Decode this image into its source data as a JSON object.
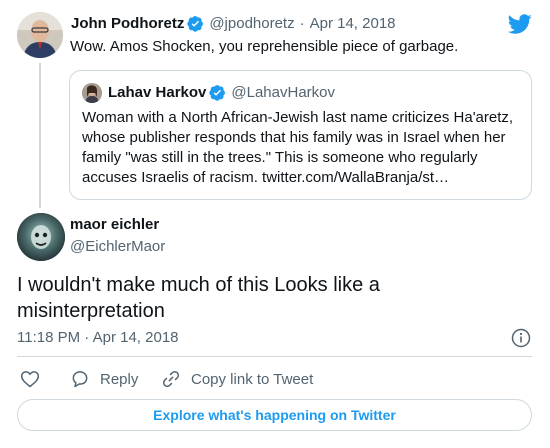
{
  "brand": {
    "logo_icon": "twitter-bird-icon",
    "accent_color": "#1d9bf0"
  },
  "parent_tweet": {
    "author_name": "John Podhoretz",
    "author_handle": "@jpodhoretz",
    "date_separator": "·",
    "date": "Apr 14, 2018",
    "text": "Wow. Amos Shocken, you reprehensible piece of garbage.",
    "verified_icon": "verified-badge-icon"
  },
  "quoted_tweet": {
    "author_name": "Lahav Harkov",
    "author_handle": "@LahavHarkov",
    "verified_icon": "verified-badge-icon",
    "text_lines": [
      "Woman with a North African-Jewish last name criticizes Ha'aretz,",
      "whose publisher responds that his family was in Israel when her",
      "family \"was still in the trees.\" This is someone who regularly",
      "accuses Israelis of racism. twitter.com/WallaBranja/st…"
    ]
  },
  "main_tweet": {
    "author_name": "maor eichler",
    "author_handle": "@EichlerMaor",
    "text_lines": [
      "I wouldn't make much of this Looks like a",
      "misinterpretation"
    ],
    "time": "11:18 PM",
    "date_separator": "·",
    "date": "Apr 14, 2018",
    "info_icon": "info-icon"
  },
  "actions": {
    "like_icon": "heart-icon",
    "reply_icon": "reply-bubble-icon",
    "reply_label": "Reply",
    "copy_icon": "link-icon",
    "copy_label": "Copy link to Tweet"
  },
  "footer": {
    "explore_label": "Explore what's happening on Twitter"
  }
}
